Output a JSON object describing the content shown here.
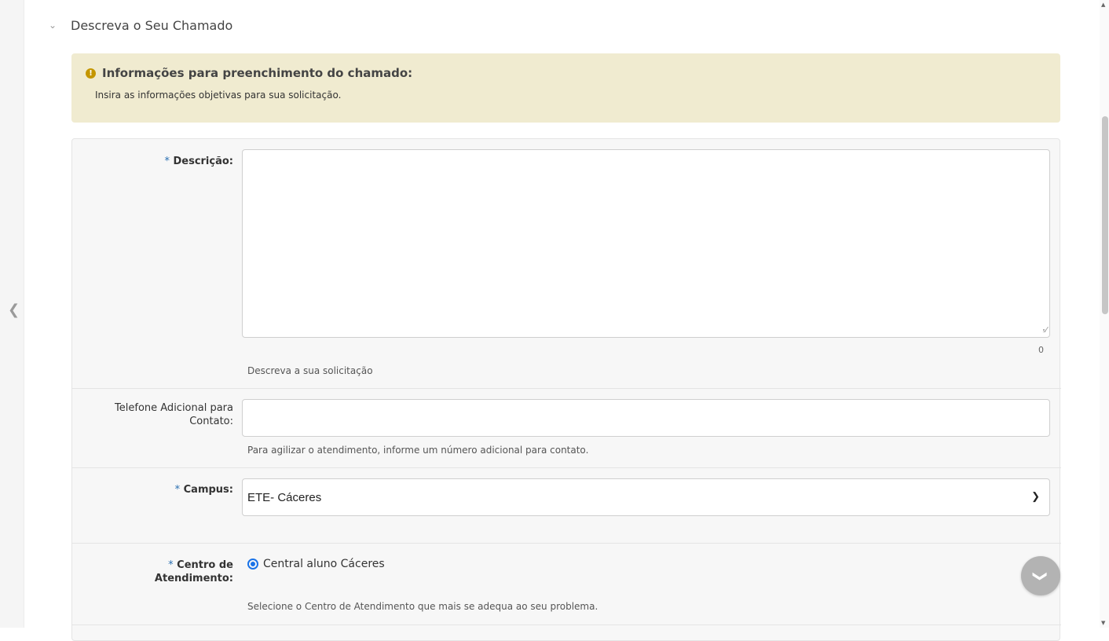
{
  "section": {
    "title": "Descreva o Seu Chamado",
    "chevron_icon": "chevron-down-icon"
  },
  "alert": {
    "title": "Informações para preenchimento do chamado:",
    "text": "Insira as informações objetivas para sua solicitação.",
    "icon": "warning-icon",
    "background": "#f0ebd0",
    "icon_color": "#c49600"
  },
  "form": {
    "required_marker": "*",
    "descricao": {
      "label": "Descrição:",
      "value": "",
      "counter": "0",
      "hint": "Descreva a sua solicitação"
    },
    "telefone": {
      "label_line1": "Telefone Adicional para",
      "label_line2": "Contato:",
      "value": "",
      "hint": "Para agilizar o atendimento, informe um número adicional para contato."
    },
    "campus": {
      "label": "Campus:",
      "selected": "ETE- Cáceres"
    },
    "centro": {
      "label_line1": "Centro de",
      "label_line2": "Atendimento:",
      "option": "Central aluno Cáceres",
      "selected": true,
      "hint": "Selecione o Centro de Atendimento que mais se adequa ao seu problema."
    }
  },
  "colors": {
    "required": "#2a6fb1",
    "radio": "#1a73e8",
    "float_button": "#b3b3b3"
  }
}
